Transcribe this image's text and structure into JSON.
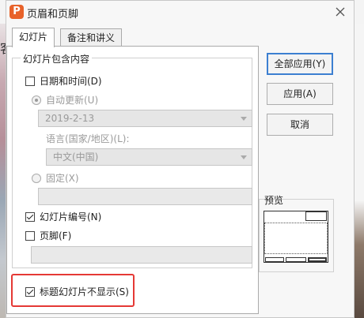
{
  "window": {
    "title": "页眉和页脚",
    "app_icon_glyph": "P"
  },
  "background": {
    "left_char": "客"
  },
  "tabs": [
    {
      "label": "幻灯片",
      "active": true
    },
    {
      "label": "备注和讲义",
      "active": false
    }
  ],
  "group": {
    "title": "幻灯片包含内容",
    "date_time": {
      "label": "日期和时间(D)",
      "checked": false
    },
    "auto_update": {
      "label": "自动更新(U)",
      "selected": true
    },
    "date_value": "2019-2-13",
    "language_label": "语言(国家/地区)(L):",
    "language_value": "中文(中国)",
    "fixed": {
      "label": "固定(X)",
      "selected": false
    },
    "fixed_value": "",
    "slide_number": {
      "label": "幻灯片编号(N)",
      "checked": true
    },
    "footer": {
      "label": "页脚(F)",
      "checked": false
    },
    "footer_value": ""
  },
  "hide_on_title": {
    "label": "标题幻灯片不显示(S)",
    "checked": true
  },
  "buttons": {
    "apply_all": "全部应用(Y)",
    "apply": "应用(A)",
    "cancel": "取消"
  },
  "preview": {
    "label": "预览"
  },
  "colors": {
    "accent": "#3c7fd1",
    "highlight": "#e53935",
    "app_icon": "#e8622a"
  },
  "icons": [
    "app-icon",
    "close-icon",
    "dropdown-arrow-icon",
    "checkbox-icon",
    "radio-icon"
  ]
}
